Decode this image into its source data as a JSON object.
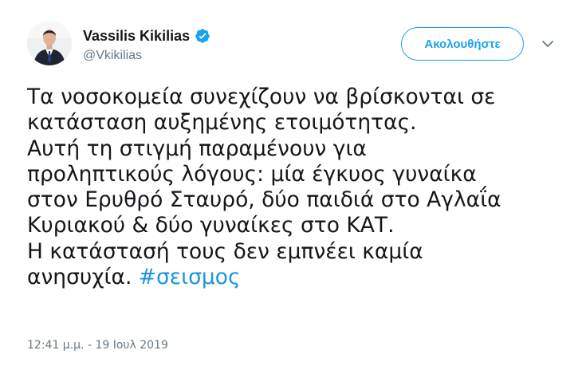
{
  "author": {
    "display_name": "Vassilis Kikilias",
    "handle": "@Vkikilias",
    "verified_icon": "verified-badge-icon",
    "avatar_icon": "profile-photo"
  },
  "follow_button": {
    "label": "Ακολουθήστε"
  },
  "menu_icon": "chevron-down-icon",
  "tweet": {
    "lines": [
      "Τα νοσοκομεία συνεχίζουν να βρίσκονται σε",
      "κατάσταση αυξημένης ετοιμότητας.",
      "Αυτή τη στιγμή παραμένουν για",
      "προληπτικούς λόγους: μία έγκυος γυναίκα",
      "στον Ερυθρό Σταυρό, δύο παιδιά στο Αγλαΐα",
      "Κυριακού & δύο γυναίκες στο ΚΑΤ.",
      "Η κατάστασή τους δεν εμπνέει καμία"
    ],
    "last_line_text": "ανησυχία. ",
    "hashtag": "#σεισμος"
  },
  "timestamp": "12:41 μ.μ. - 19 Ιουλ 2019",
  "colors": {
    "accent": "#1da1f2",
    "hashtag": "#1b95e0",
    "secondary_text": "#657786",
    "primary_text": "#14171a"
  }
}
